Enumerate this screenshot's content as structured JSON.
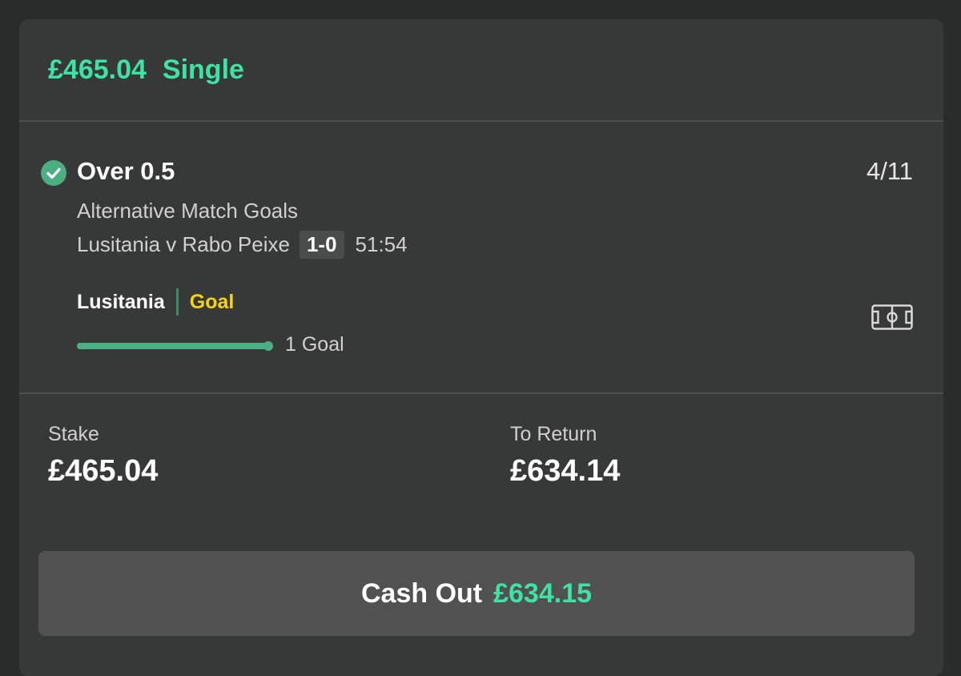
{
  "bet_header": {
    "amount": "£465.04",
    "type": "Single"
  },
  "selection": {
    "name": "Over 0.5",
    "odds": "4/11",
    "market": "Alternative Match Goals",
    "event": "Lusitania v Rabo Peixe",
    "score": "1-0",
    "clock": "51:54",
    "incident_team": "Lusitania",
    "incident_type": "Goal",
    "progress_label": "1 Goal",
    "progress_fraction": 1.0
  },
  "stake": {
    "label": "Stake",
    "value": "£465.04"
  },
  "to_return": {
    "label": "To Return",
    "value": "£634.14"
  },
  "cashout": {
    "label": "Cash Out",
    "amount": "£634.15"
  },
  "colors": {
    "accent": "#3ee2a3",
    "success": "#4caf84",
    "goal_highlight": "#f5d218",
    "card_bg": "#373938",
    "page_bg": "#2a2b2b"
  },
  "icons": {
    "status": "check-circle-icon",
    "pitch": "pitch-icon"
  }
}
